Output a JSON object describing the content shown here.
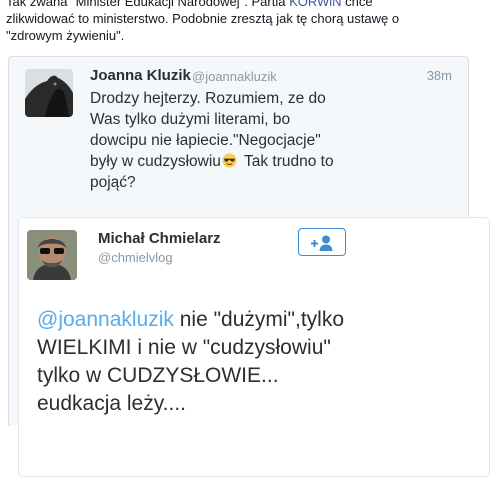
{
  "post": {
    "line1_pre": "Tak zwana \"Minister Edukacji Narodowej\". Partia ",
    "line1_link": "KORWiN",
    "line1_post": " chce",
    "line2": "zlikwidować to ministerstwo. Podobnie zresztą jak tę chorą ustawę o",
    "line3": "\"zdrowym żywieniu\"."
  },
  "tweet1": {
    "name": "Joanna Kluzik",
    "handle": "@joannakluzik",
    "time": "38m",
    "lines": [
      "Drodzy hejterzy. Rozumiem, ze do",
      "Was tylko dużymi literami, bo",
      "dowcipu nie łapiecie.\"Negocjacje\"",
      "były w cudzysłowiu",
      " Tak trudno to",
      "pojąć?"
    ],
    "emoji": "smiling-face-with-sunglasses"
  },
  "tweet2": {
    "name": "Michał Chmielarz",
    "handle": "@chmielvlog",
    "mention": "@joannakluzik",
    "lines": [
      " nie \"dużymi\",tylko",
      "WIELKIMI i nie w \"cudzysłowiu\"",
      "tylko w CUDZYSŁOWIE...",
      "eudkacja leży...."
    ]
  },
  "colors": {
    "link": "#3b5998",
    "twitter_blue": "#55acee",
    "follow_border": "#3d8ccf"
  }
}
